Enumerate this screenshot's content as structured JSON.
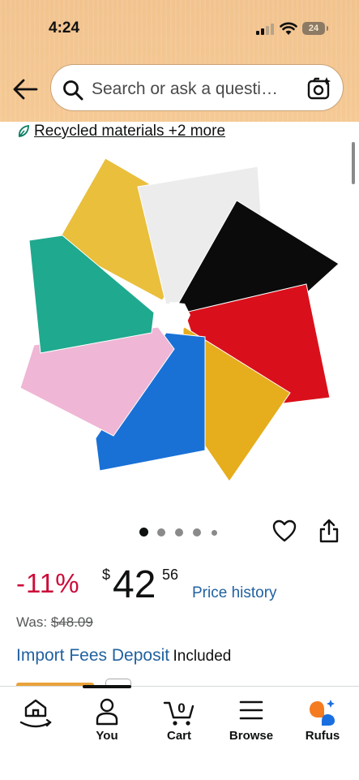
{
  "status_bar": {
    "time": "4:24",
    "battery": "24"
  },
  "search": {
    "placeholder": "Search or ask a questi…"
  },
  "sustainability": {
    "label": "Recycled materials +2 more"
  },
  "image_carousel": {
    "dot_count": 5,
    "active_index": 0
  },
  "price": {
    "discount": "-11%",
    "currency_symbol": "$",
    "whole": "42",
    "fraction": "56",
    "history_link": "Price history",
    "was_label": "Was:",
    "was_value": "$48.09"
  },
  "import_fees": {
    "label": "Import Fees Deposit",
    "status": "Included"
  },
  "bottom_nav": {
    "cart_count": "0",
    "items": [
      {
        "id": "home",
        "label": ""
      },
      {
        "id": "you",
        "label": "You"
      },
      {
        "id": "cart",
        "label": "Cart"
      },
      {
        "id": "browse",
        "label": "Browse"
      },
      {
        "id": "rufus",
        "label": "Rufus"
      }
    ]
  },
  "colors": {
    "header_bg": "#f5c994",
    "link": "#2162a1",
    "discount": "#cc0c39",
    "swatches": [
      "#e9bf3c",
      "#ececec",
      "#0b0b0b",
      "#d9101b",
      "#e6ad1c",
      "#1971d6",
      "#efb6d5",
      "#1fa98f"
    ]
  }
}
